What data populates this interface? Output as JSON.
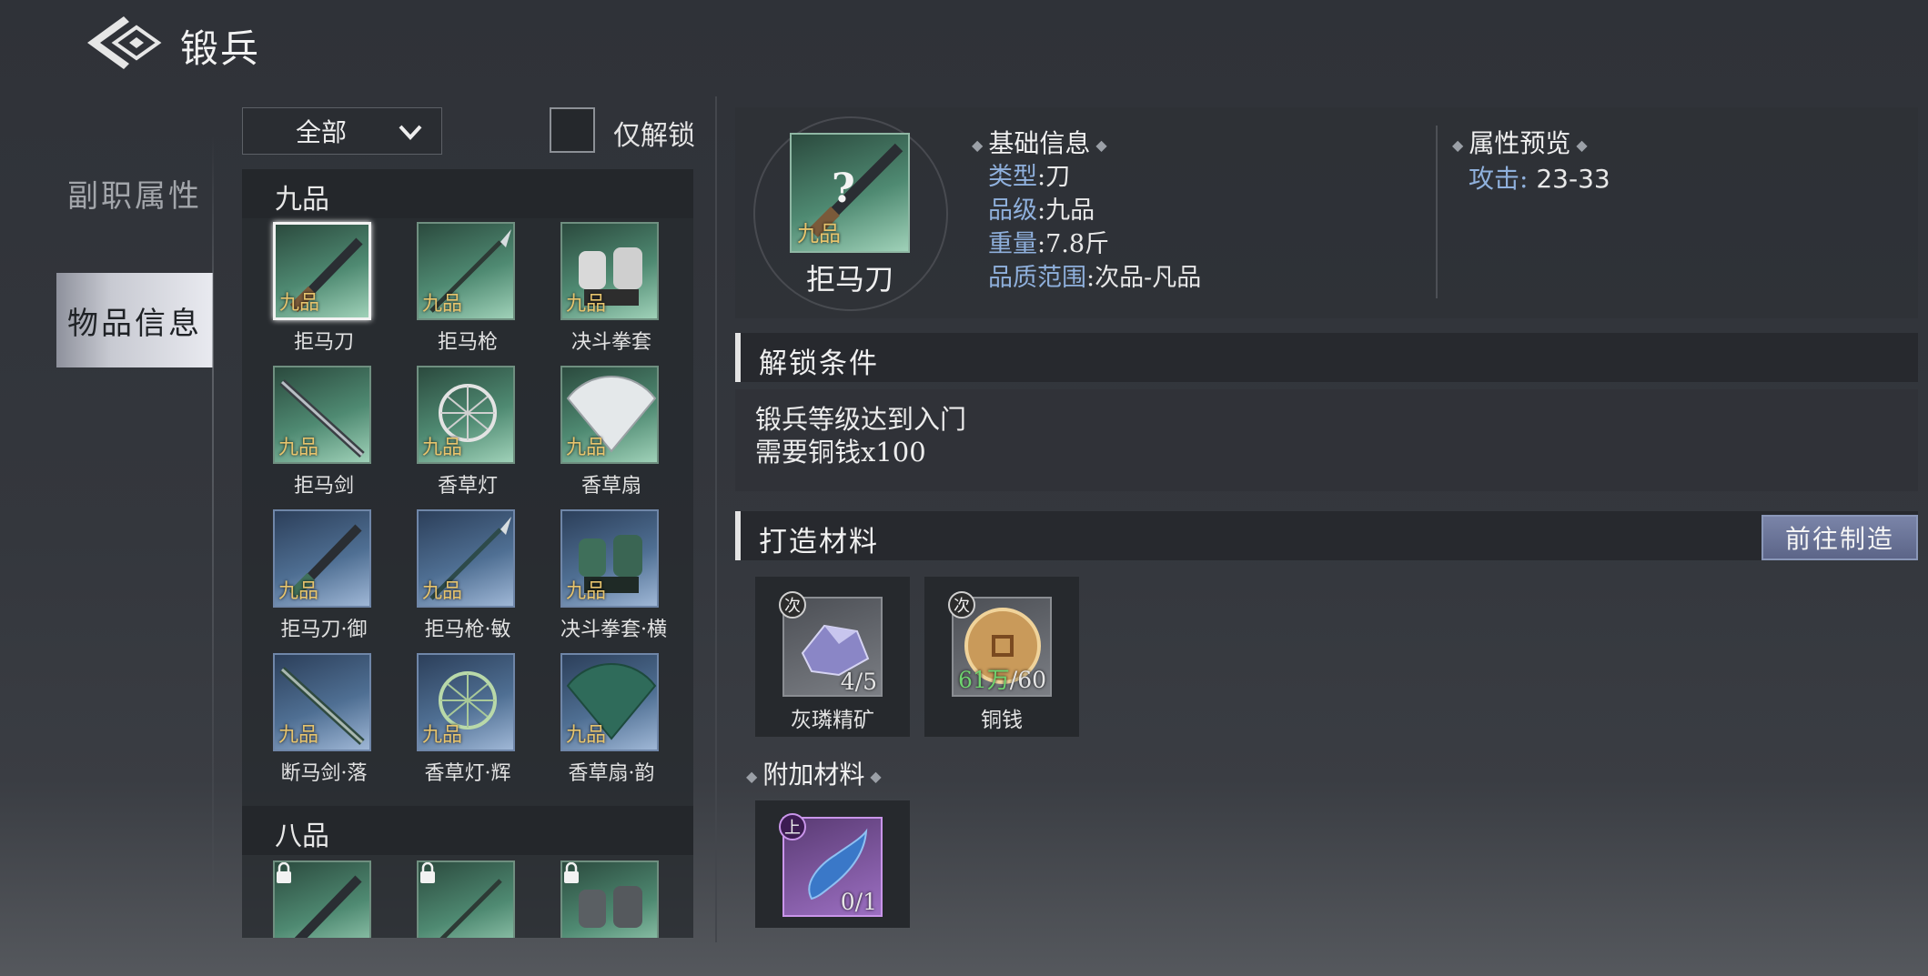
{
  "header": {
    "title": "锻兵"
  },
  "tabs": [
    {
      "label": "副职属性"
    },
    {
      "label": "物品信息"
    }
  ],
  "filter": {
    "dropdown_value": "全部",
    "checkbox_label": "仅解锁"
  },
  "groups": [
    {
      "label": "九品"
    },
    {
      "label": "八品"
    }
  ],
  "grade_tag": "九品",
  "items": [
    {
      "name": "拒马刀"
    },
    {
      "name": "拒马枪"
    },
    {
      "name": "决斗拳套"
    },
    {
      "name": "拒马剑"
    },
    {
      "name": "香草灯"
    },
    {
      "name": "香草扇"
    },
    {
      "name": "拒马刀·御"
    },
    {
      "name": "拒马枪·敏"
    },
    {
      "name": "决斗拳套·横"
    },
    {
      "name": "断马剑·落"
    },
    {
      "name": "香草灯·辉"
    },
    {
      "name": "香草扇·韵"
    }
  ],
  "selected_item": {
    "name": "拒马刀",
    "grade_tag": "九品",
    "unknown_mark": "?"
  },
  "basic_info": {
    "heading": "基础信息",
    "type_label": "类型",
    "type_value": ":刀",
    "grade_label": "品级",
    "grade_value": ":九品",
    "weight_label": "重量",
    "weight_value": ":7.8斤",
    "quality_label": "品质范围",
    "quality_value": ":次品-凡品"
  },
  "attr_preview": {
    "heading": "属性预览",
    "attack_label": "攻击:",
    "attack_value": "23-33"
  },
  "unlock": {
    "heading": "解锁条件",
    "line1": "锻兵等级达到入门",
    "line2": "需要铜钱x100"
  },
  "forge": {
    "heading": "打造材料",
    "goto_button": "前往制造",
    "materials": [
      {
        "name": "灰璘精矿",
        "badge": "次",
        "have": "4",
        "need": "/5"
      },
      {
        "name": "铜钱",
        "badge": "次",
        "have": "61万",
        "need": "/60"
      }
    ]
  },
  "extra": {
    "heading": "附加材料",
    "materials": [
      {
        "badge": "上",
        "count": "0/1"
      }
    ]
  },
  "colors": {
    "label_blue": "#8fb0dc",
    "grade_gold": "#e7c46d",
    "count_green": "#6fd36f",
    "green_frame": "#4f8a72",
    "blue_frame": "#4f6f93"
  }
}
